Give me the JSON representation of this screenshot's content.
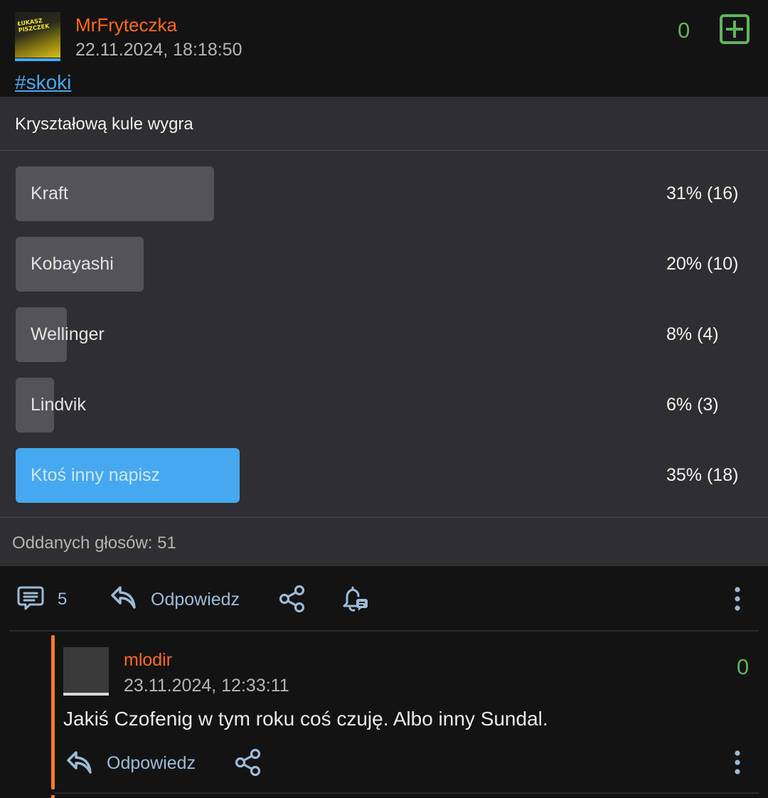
{
  "post": {
    "username": "MrFryteczka",
    "timestamp": "22.11.2024, 18:18:50",
    "score": "0",
    "hashtag": "#skoki",
    "avatar_text": "ŁUKASZ PISZCZEK"
  },
  "poll": {
    "title": "Kryształową kule wygra",
    "options": [
      {
        "label": "Kraft",
        "result": "31% (16)",
        "percent": 31,
        "votes": 16,
        "selected": false
      },
      {
        "label": "Kobayashi",
        "result": "20% (10)",
        "percent": 20,
        "votes": 10,
        "selected": false
      },
      {
        "label": "Wellinger",
        "result": "8% (4)",
        "percent": 8,
        "votes": 4,
        "selected": false
      },
      {
        "label": "Lindvik",
        "result": "6% (3)",
        "percent": 6,
        "votes": 3,
        "selected": false
      },
      {
        "label": "Ktoś inny napisz",
        "result": "35% (18)",
        "percent": 35,
        "votes": 18,
        "selected": true
      }
    ],
    "total_votes": "Oddanych głosów: 51"
  },
  "actions": {
    "comments_count": "5",
    "reply_label": "Odpowiedz",
    "icons": [
      "comments-icon",
      "reply-icon",
      "share-icon",
      "bell-icon",
      "more-icon"
    ]
  },
  "comment": {
    "username": "mlodir",
    "timestamp": "23.11.2024, 12:33:11",
    "score": "0",
    "text": "Jakiś Czofenig w tym roku coś czuję. Albo inny Sundal.",
    "reply_label": "Odpowiedz"
  },
  "colors": {
    "background": "#131314",
    "poll_background": "#2e2e33",
    "accent_blue": "#46a8ef",
    "username_orange": "#ff6a1f",
    "score_green": "#5fb55a",
    "action_blue": "#9dbbd6",
    "bar_grey": "#535359"
  }
}
